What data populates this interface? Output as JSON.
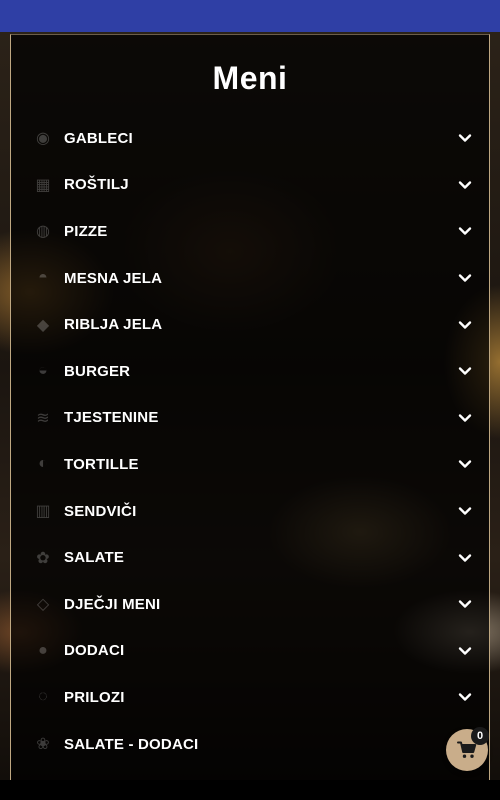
{
  "colors": {
    "status_bar": "#2f3fa5",
    "panel_border": "#bfa882",
    "cart_button": "#c9ad8a",
    "text": "#ffffff"
  },
  "page": {
    "title": "Meni"
  },
  "menu": {
    "items": [
      {
        "label": "GABLECI",
        "icon": "bowl-icon"
      },
      {
        "label": "ROŠTILJ",
        "icon": "grill-icon"
      },
      {
        "label": "PIZZE",
        "icon": "pizza-icon"
      },
      {
        "label": "MESNA JELA",
        "icon": "meat-icon"
      },
      {
        "label": "RIBLJA JELA",
        "icon": "fish-icon"
      },
      {
        "label": "BURGER",
        "icon": "burger-icon"
      },
      {
        "label": "TJESTENINE",
        "icon": "pasta-icon"
      },
      {
        "label": "TORTILLE",
        "icon": "tortilla-icon"
      },
      {
        "label": "SENDVIČI",
        "icon": "sandwich-icon"
      },
      {
        "label": "SALATE",
        "icon": "salad-icon"
      },
      {
        "label": "DJEČJI MENI",
        "icon": "kids-meal-icon"
      },
      {
        "label": "DODACI",
        "icon": "extras-icon"
      },
      {
        "label": "PRILOZI",
        "icon": "side-dish-icon"
      },
      {
        "label": "SALATE - DODACI",
        "icon": "salad-extras-icon"
      }
    ]
  },
  "cart": {
    "count": "0",
    "icon": "cart-icon"
  }
}
